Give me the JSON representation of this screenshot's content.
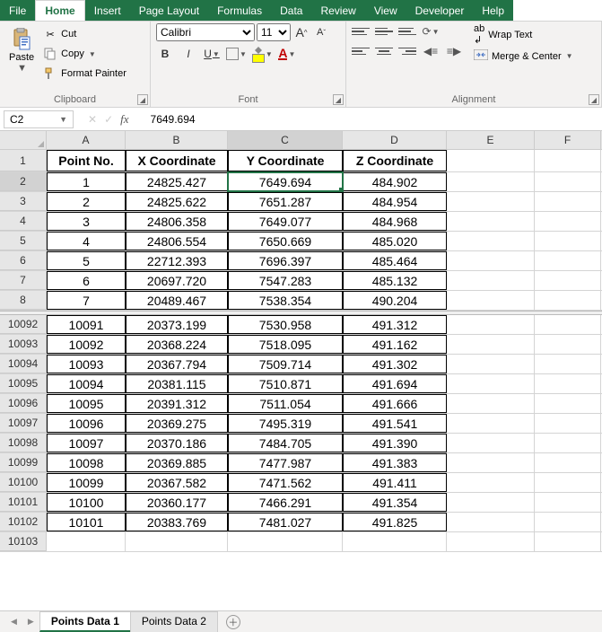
{
  "menu": {
    "tabs": [
      "File",
      "Home",
      "Insert",
      "Page Layout",
      "Formulas",
      "Data",
      "Review",
      "View",
      "Developer",
      "Help"
    ],
    "active": "Home"
  },
  "ribbon": {
    "clipboard": {
      "label": "Clipboard",
      "paste": "Paste",
      "cut": "Cut",
      "copy": "Copy",
      "format_painter": "Format Painter"
    },
    "font": {
      "label": "Font",
      "name": "Calibri",
      "size": "11",
      "increase": "A",
      "decrease": "A",
      "bold": "B",
      "italic": "I",
      "underline": "U",
      "font_color_letter": "A"
    },
    "alignment": {
      "label": "Alignment",
      "wrap": "Wrap Text",
      "merge": "Merge & Center"
    }
  },
  "formula_bar": {
    "namebox": "C2",
    "fx": "fx",
    "value": "7649.694"
  },
  "columns": [
    "A",
    "B",
    "C",
    "D",
    "E",
    "F"
  ],
  "headers": {
    "A": "Point No.",
    "B": "X Coordinate",
    "C": "Y Coordinate",
    "D": "Z Coordinate"
  },
  "top_rows": [
    {
      "r": "2",
      "A": "1",
      "B": "24825.427",
      "C": "7649.694",
      "D": "484.902"
    },
    {
      "r": "3",
      "A": "2",
      "B": "24825.622",
      "C": "7651.287",
      "D": "484.954"
    },
    {
      "r": "4",
      "A": "3",
      "B": "24806.358",
      "C": "7649.077",
      "D": "484.968"
    },
    {
      "r": "5",
      "A": "4",
      "B": "24806.554",
      "C": "7650.669",
      "D": "485.020"
    },
    {
      "r": "6",
      "A": "5",
      "B": "22712.393",
      "C": "7696.397",
      "D": "485.464"
    },
    {
      "r": "7",
      "A": "6",
      "B": "20697.720",
      "C": "7547.283",
      "D": "485.132"
    },
    {
      "r": "8",
      "A": "7",
      "B": "20489.467",
      "C": "7538.354",
      "D": "490.204"
    }
  ],
  "bottom_rows": [
    {
      "r": "10092",
      "A": "10091",
      "B": "20373.199",
      "C": "7530.958",
      "D": "491.312"
    },
    {
      "r": "10093",
      "A": "10092",
      "B": "20368.224",
      "C": "7518.095",
      "D": "491.162"
    },
    {
      "r": "10094",
      "A": "10093",
      "B": "20367.794",
      "C": "7509.714",
      "D": "491.302"
    },
    {
      "r": "10095",
      "A": "10094",
      "B": "20381.115",
      "C": "7510.871",
      "D": "491.694"
    },
    {
      "r": "10096",
      "A": "10095",
      "B": "20391.312",
      "C": "7511.054",
      "D": "491.666"
    },
    {
      "r": "10097",
      "A": "10096",
      "B": "20369.275",
      "C": "7495.319",
      "D": "491.541"
    },
    {
      "r": "10098",
      "A": "10097",
      "B": "20370.186",
      "C": "7484.705",
      "D": "491.390"
    },
    {
      "r": "10099",
      "A": "10098",
      "B": "20369.885",
      "C": "7477.987",
      "D": "491.383"
    },
    {
      "r": "10100",
      "A": "10099",
      "B": "20367.582",
      "C": "7471.562",
      "D": "491.411"
    },
    {
      "r": "10101",
      "A": "10100",
      "B": "20360.177",
      "C": "7466.291",
      "D": "491.354"
    },
    {
      "r": "10102",
      "A": "10101",
      "B": "20383.769",
      "C": "7481.027",
      "D": "491.825"
    }
  ],
  "empty_row": "10103",
  "selected": {
    "row": "2",
    "col": "C"
  },
  "sheets": {
    "tabs": [
      "Points Data 1",
      "Points Data 2"
    ],
    "active": "Points Data 1"
  }
}
